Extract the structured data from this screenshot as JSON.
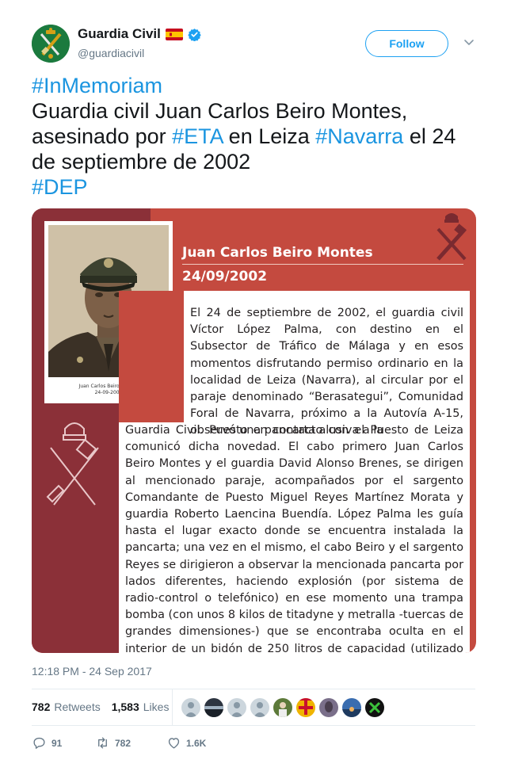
{
  "account": {
    "display_name": "Guardia Civil",
    "handle": "@guardiacivil",
    "verified": true,
    "flag_icon": "spain-flag-icon",
    "verified_icon": "verified-badge-icon",
    "avatar_icon": "guardia-civil-emblem-icon"
  },
  "header": {
    "follow_label": "Follow",
    "more_icon": "chevron-down-icon"
  },
  "tweet": {
    "hashtag_1": "#InMemoriam",
    "text_1": "Guardia civil Juan Carlos Beiro Montes, asesinado por ",
    "hashtag_2": "#ETA",
    "text_2": " en Leiza ",
    "hashtag_3": "#Navarra",
    "text_3": " el 24 de septiembre de 2002",
    "hashtag_4": "#DEP"
  },
  "media": {
    "photo_caption_name": "Juan Carlos Beiro Montes",
    "photo_caption_date": "24-09-2002",
    "title": "Juan Carlos Beiro Montes",
    "date": "24/09/2002",
    "body_top": "El 24 de septiembre de 2002, el guardia civil Víctor López Palma, con destino en el Subsector de Tráfico de Málaga y en esos momentos disfrutando permiso ordinario en la localidad de Leiza (Navarra), al circular por el paraje denominado “Berasategui”, Comunidad Foral de Navarra, próximo a la Autovía A-15, observó una pancarta alusiva a la",
    "body_bottom": "Guardia Civil. Puesto en contacto con el Puesto de Leiza comunicó dicha novedad. El cabo primero Juan Carlos Beiro Montes y el guardia David Alonso Brenes, se dirigen al mencionado paraje, acompañados por el sargento Comandante de Puesto Miguel Reyes Martínez Morata y guardia Roberto Laencina Buendía. López Palma les guía hasta el lugar exacto donde se encuentra instalada la pancarta; una vez en el mismo, el cabo Beiro y el sargento Reyes se dirigieron a observar la mencionada pancarta por lados diferentes, haciendo explosión (por sistema de radio-control o telefónico) en ese momento una trampa bomba (con unos 8 kilos de titadyne y metralla -tuercas de grandes dimensiones-) que se encontraba oculta en el interior de un bidón de 250 litros de capacidad (utilizado como basurero) situado junto a la pancarta. En el lugar de la explosión",
    "colors": {
      "primary_red": "#c44a3f",
      "dark_red": "#8b3038"
    }
  },
  "meta": {
    "timestamp": "12:18 PM - 24 Sep 2017"
  },
  "stats": {
    "retweets_count": "782",
    "retweets_label": "Retweets",
    "likes_count": "1,583",
    "likes_label": "Likes",
    "likers": [
      "default-avatar-icon",
      "landscape-avatar-icon",
      "default-avatar-icon",
      "default-avatar-icon",
      "person-avatar-icon",
      "cross-flag-avatar-icon",
      "portrait-avatar-icon",
      "sunset-avatar-icon",
      "green-logo-avatar-icon"
    ]
  },
  "actions": {
    "reply_count": "91",
    "retweet_count": "782",
    "like_count": "1.6K",
    "reply_icon": "reply-icon",
    "retweet_icon": "retweet-icon",
    "like_icon": "heart-icon"
  },
  "colors": {
    "link": "#1b95e0",
    "follow": "#1da1f2",
    "muted": "#657786"
  }
}
